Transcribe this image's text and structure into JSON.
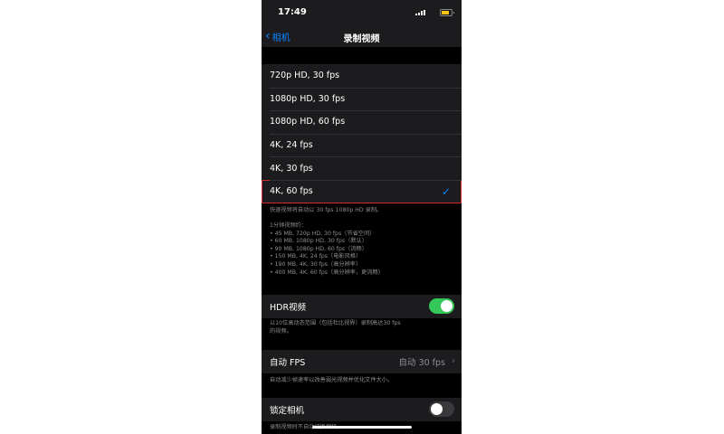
{
  "status_bar": {
    "time": "17:49"
  },
  "nav": {
    "back_label": "相机",
    "title": "录制视频"
  },
  "resolutions": [
    {
      "label": "720p HD, 30 fps"
    },
    {
      "label": "1080p HD, 30 fps"
    },
    {
      "label": "1080p HD, 60 fps"
    },
    {
      "label": "4K, 24 fps"
    },
    {
      "label": "4K, 30 fps"
    },
    {
      "label": "4K, 60 fps"
    }
  ],
  "selected_index": 5,
  "notes": {
    "slow_note": "快速视频将自动以 30 fps 1080p HD 录制。",
    "size_info": "1分钟视频约：\n• 45 MB, 720p HD, 30 fps（节省空间）\n• 60 MB, 1080p HD, 30 fps（默认）\n• 90 MB, 1080p HD, 60 fps（流畅）\n• 150 MB, 4K, 24 fps（电影风格）\n• 190 MB, 4K, 30 fps（高分辨率）\n• 400 MB, 4K, 60 fps（高分辨率，更流畅）"
  },
  "hdr": {
    "label": "HDR视频",
    "enabled": true,
    "note": "以10位高动态范围（包括杜比视界）录制高达30 fps\n的视频。"
  },
  "auto_fps": {
    "label": "自动 FPS",
    "value": "自动 30 fps",
    "note": "自动减少帧速率以改善弱光视频并优化文件大小。"
  },
  "lock_camera": {
    "label": "锁定相机",
    "enabled": false,
    "note": "录制视频时不自动切换相机。"
  },
  "colors": {
    "accent": "#0a84ff",
    "toggle_on": "#34c759",
    "highlight": "#d32b2b"
  }
}
